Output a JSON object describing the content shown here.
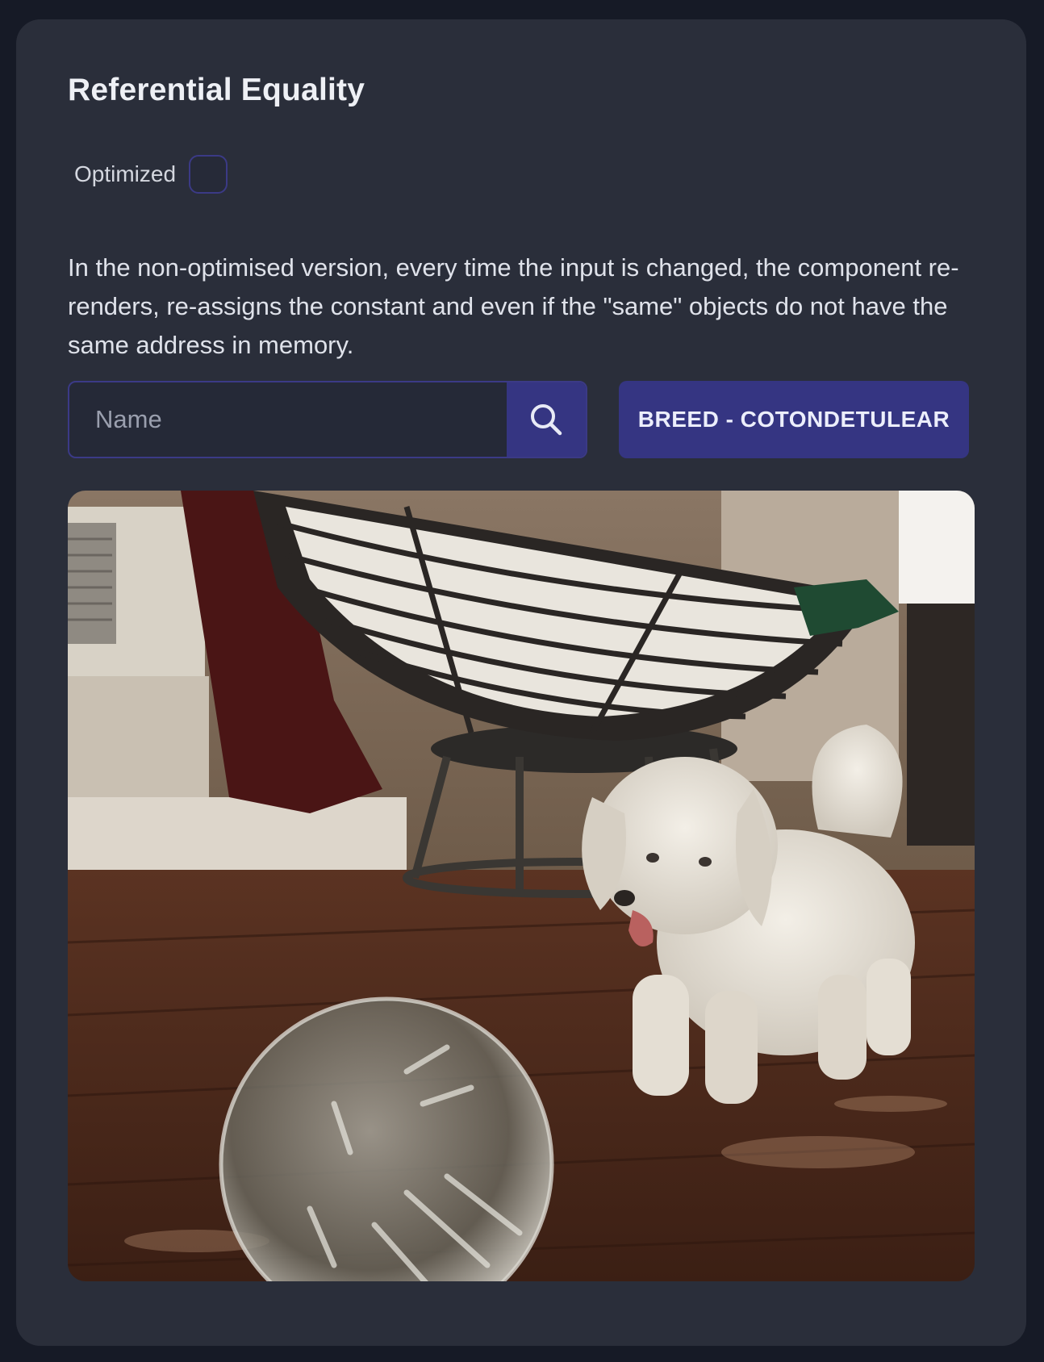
{
  "card": {
    "title": "Referential Equality",
    "optimized_label": "Optimized",
    "optimized_checked": false,
    "description": "In the non-optimised version, every time the input is changed, the component re-renders, re-assigns the constant and even if the \"same\" objects do not have the same address in memory.",
    "search": {
      "placeholder": "Name",
      "value": "",
      "button_icon": "search-icon"
    },
    "breed_button_label": "BREED - COTONDETULEAR",
    "image": {
      "subject": "dog-photo"
    }
  },
  "colors": {
    "page_background": "#161a26",
    "card_background": "#2a2e3a",
    "accent": "#353582",
    "accent_border": "#3b3a86",
    "text_primary": "#eef0f5"
  }
}
